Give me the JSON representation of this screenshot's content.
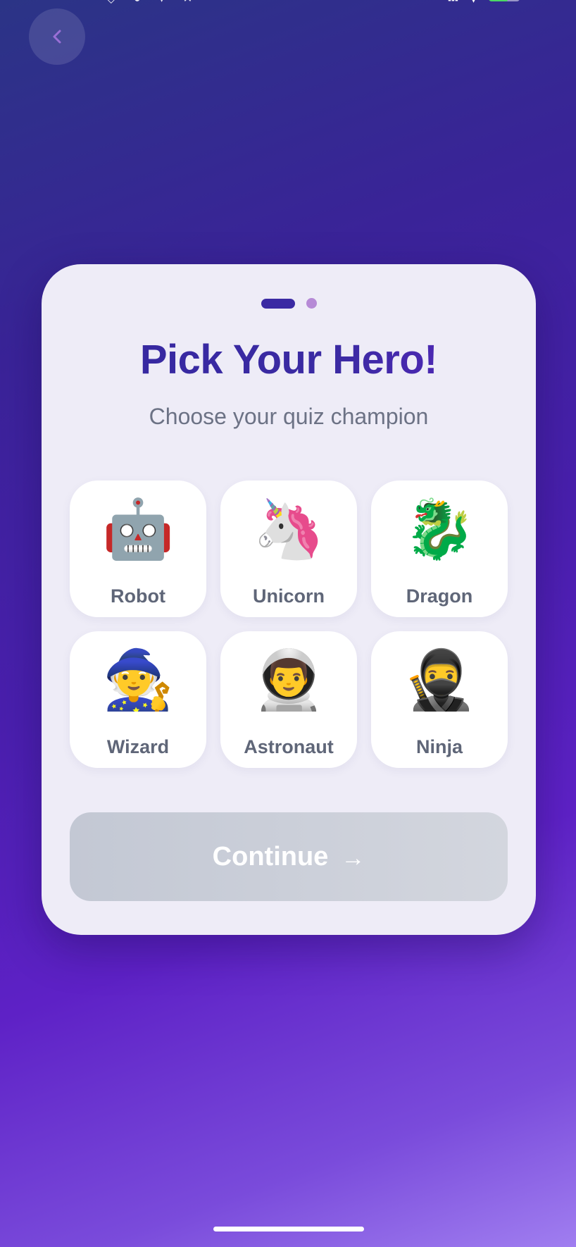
{
  "status_bar": {
    "left_icons": [
      "notification-icon",
      "location-icon",
      "globe-icon",
      "pin-icon",
      "x-icon"
    ],
    "right_icons": [
      "signal-icon",
      "wifi-icon",
      "battery-icon"
    ],
    "battery_color": "#4cd964"
  },
  "back_button": {
    "icon": "chevron-left-icon",
    "icon_color": "#9a6fd6"
  },
  "onboarding": {
    "step_indicator": {
      "current": 1,
      "total": 2
    },
    "title": "Pick Your Hero!",
    "subtitle": "Choose your quiz champion",
    "heroes": [
      {
        "emoji": "🤖",
        "label": "Robot",
        "icon": "robot-icon"
      },
      {
        "emoji": "🦄",
        "label": "Unicorn",
        "icon": "unicorn-icon"
      },
      {
        "emoji": "🐉",
        "label": "Dragon",
        "icon": "dragon-icon"
      },
      {
        "emoji": "🧙",
        "label": "Wizard",
        "icon": "wizard-icon"
      },
      {
        "emoji": "👨‍🚀",
        "label": "Astronaut",
        "icon": "astronaut-icon"
      },
      {
        "emoji": "🥷",
        "label": "Ninja",
        "icon": "ninja-icon"
      }
    ],
    "continue_button": {
      "label": "Continue",
      "arrow": "→",
      "enabled": false
    }
  },
  "colors": {
    "accent": "#3b2aa3",
    "card_background": "#eeecf7",
    "disabled_button": "#c3c8d4",
    "label_text": "#5f6678"
  }
}
